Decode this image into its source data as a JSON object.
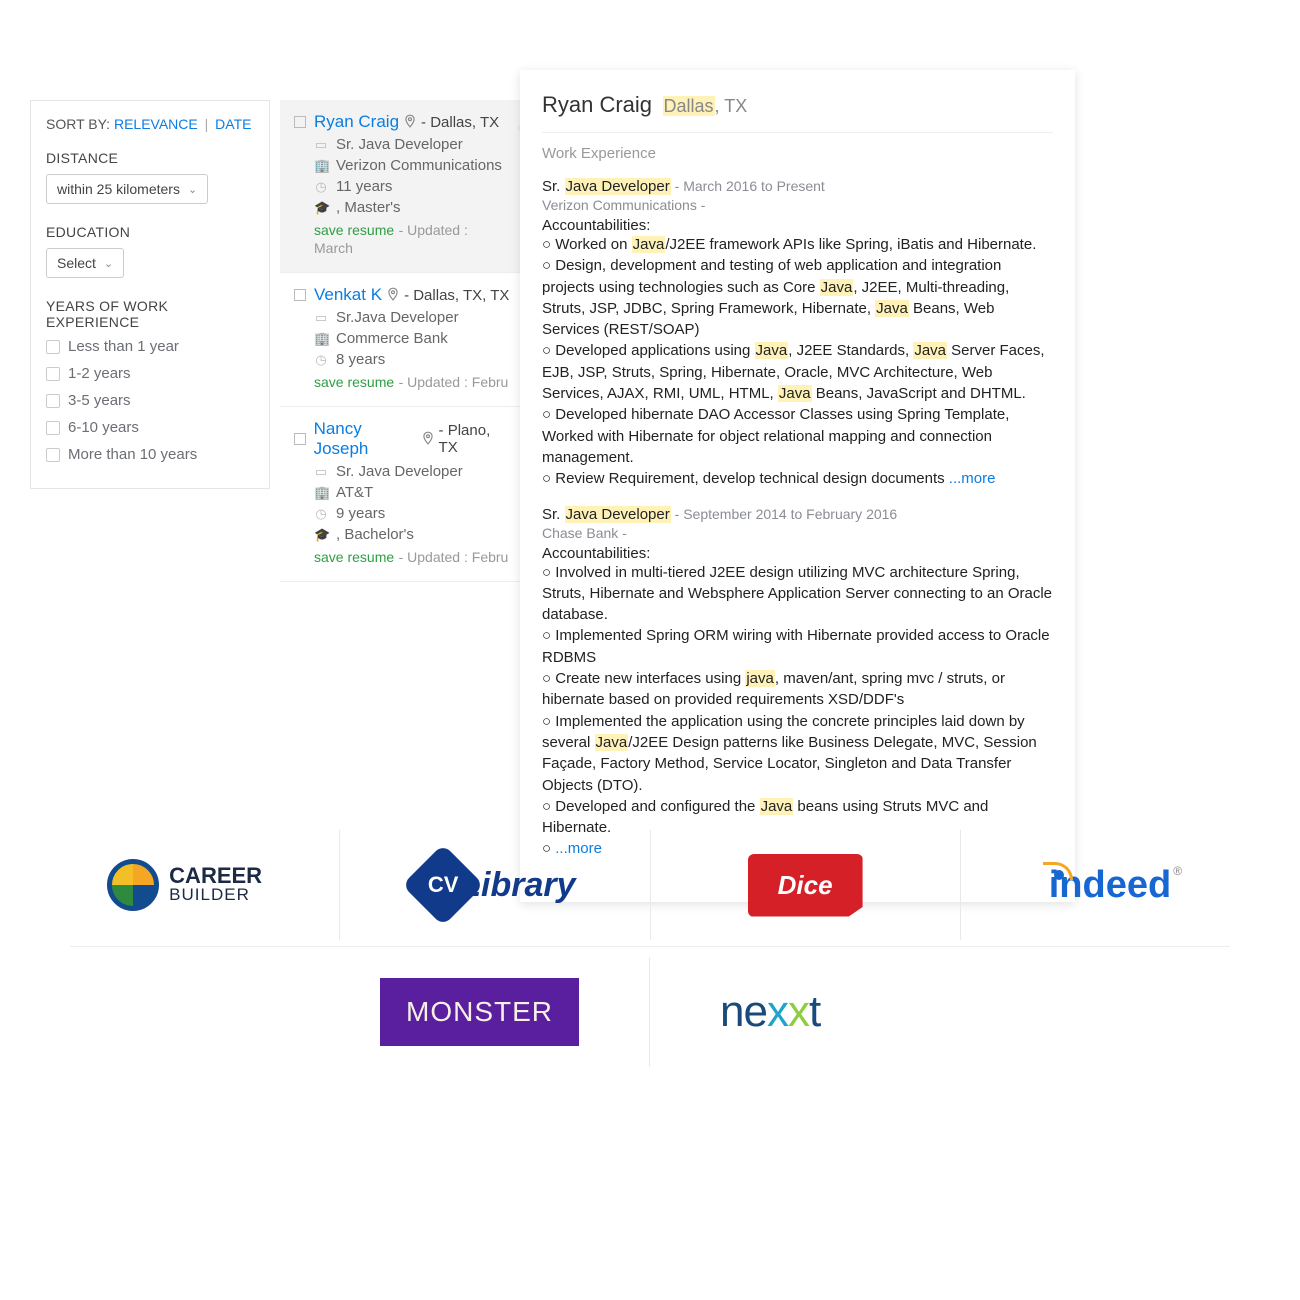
{
  "sort": {
    "label": "SORT BY:",
    "relevance": "RELEVANCE",
    "date": "DATE",
    "sep": "|"
  },
  "distance": {
    "label": "DISTANCE",
    "value": "within 25 kilometers"
  },
  "education": {
    "label": "EDUCATION",
    "value": "Select"
  },
  "experience": {
    "label": "YEARS OF WORK EXPERIENCE",
    "options": [
      "Less than 1 year",
      "1-2 years",
      "3-5 years",
      "6-10 years",
      "More than 10 years"
    ]
  },
  "results": [
    {
      "name": "Ryan Craig",
      "location": "- Dallas, TX",
      "title": "Sr. Java Developer",
      "company": "Verizon Communications",
      "years": "11 years",
      "degree": ", Master's",
      "save": "save resume",
      "updated": "- Updated : March"
    },
    {
      "name": "Venkat K",
      "location": "- Dallas, TX, TX",
      "title": "Sr.Java Developer",
      "company": "Commerce Bank",
      "years": "8 years",
      "degree": "",
      "save": "save resume",
      "updated": "- Updated : Febru"
    },
    {
      "name": "Nancy Joseph",
      "location": "- Plano, TX",
      "title": "Sr. Java Developer",
      "company": "AT&T",
      "years": "9 years",
      "degree": ", Bachelor's",
      "save": "save resume",
      "updated": "- Updated : Febru"
    }
  ],
  "detail": {
    "name": "Ryan Craig",
    "city": "Dallas",
    "state": ", TX",
    "section": "Work Experience",
    "jobs": [
      {
        "title_pre": "Sr. ",
        "title_hl": "Java Developer",
        "date": " - March 2016 to Present",
        "company": "Verizon Communications -",
        "acc_label": "Accountabilities:",
        "bullets": [
          {
            "pre": "Worked on ",
            "hl": "Java",
            "post": "/J2EE framework APIs like Spring, iBatis and Hibernate."
          },
          {
            "pre": "Design, development and testing of web application and integration projects using technologies such as Core ",
            "hl": "Java",
            "post": ", J2EE, Multi-threading, Struts, JSP, JDBC, Spring Framework, Hibernate, ",
            "hl2": "Java",
            "post2": " Beans, Web Services (REST/SOAP)"
          },
          {
            "pre": "Developed applications using ",
            "hl": "Java",
            "post": ", J2EE Standards, ",
            "hl2": "Java",
            "post2": " Server Faces, EJB, JSP, Struts, Spring, Hibernate, Oracle, MVC Architecture, Web Services, AJAX, RMI, UML, HTML, ",
            "hl3": "Java",
            "post3": " Beans, JavaScript and DHTML."
          },
          {
            "pre": "Developed hibernate DAO Accessor Classes using Spring Template, Worked with Hibernate for object relational mapping and connection management.",
            "hl": "",
            "post": ""
          },
          {
            "pre": "Review Requirement, develop technical design documents ",
            "hl": "",
            "post": "",
            "more": "...more"
          }
        ]
      },
      {
        "title_pre": "Sr. ",
        "title_hl": "Java Developer",
        "date": " - September 2014 to February 2016",
        "company": "Chase Bank -",
        "acc_label": "Accountabilities:",
        "bullets": [
          {
            "pre": "Involved in multi-tiered J2EE design utilizing MVC architecture Spring, Struts, Hibernate and Websphere Application Server connecting to an Oracle database.",
            "hl": "",
            "post": ""
          },
          {
            "pre": "Implemented Spring ORM wiring with Hibernate provided access to Oracle RDBMS",
            "hl": "",
            "post": ""
          },
          {
            "pre": "Create new interfaces using ",
            "hl": "java",
            "post": ", maven/ant, spring mvc / struts, or hibernate based on provided requirements XSD/DDF's"
          },
          {
            "pre": "Implemented the application using the concrete principles laid down by several ",
            "hl": "Java",
            "post": "/J2EE Design patterns like Business Delegate, MVC, Session Façade, Factory Method, Service Locator, Singleton and Data Transfer Objects (DTO)."
          },
          {
            "pre": "Developed and configured the ",
            "hl": "Java",
            "post": " beans using Struts MVC and Hibernate."
          },
          {
            "pre": "",
            "hl": "",
            "post": "",
            "more": "...more"
          }
        ]
      }
    ]
  },
  "logos": {
    "careerbuilder": {
      "line1": "CAREER",
      "line2": "BUILDER"
    },
    "cvlibrary": {
      "badge": "CV",
      "text": "Library"
    },
    "dice": "Dice",
    "indeed": "indeed",
    "monster": "MONSTER",
    "nexxt": {
      "p1": "ne",
      "p2": "x",
      "p3": "x",
      "p4": "t"
    }
  }
}
